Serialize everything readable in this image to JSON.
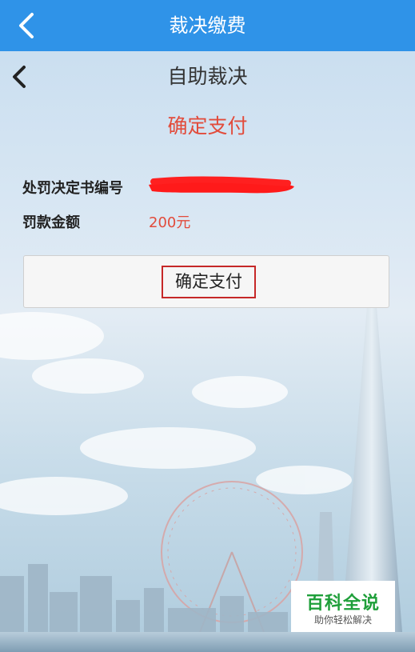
{
  "top_bar": {
    "title": "裁决缴费",
    "back_icon": "chevron-left-icon"
  },
  "sub_bar": {
    "title": "自助裁决",
    "back_icon": "chevron-left-icon"
  },
  "confirm_heading": "确定支付",
  "fields": [
    {
      "label": "处罚决定书编号",
      "value": "",
      "redacted": true
    },
    {
      "label": "罚款金额",
      "value": "200元"
    }
  ],
  "pay_button": {
    "label": "确定支付"
  },
  "watermark": {
    "main": "百科全说",
    "sub": "助你轻松解决"
  },
  "colors": {
    "header": "#2f93e8",
    "accent_red": "#e24b3b",
    "watermark_green": "#1f9f3a"
  }
}
